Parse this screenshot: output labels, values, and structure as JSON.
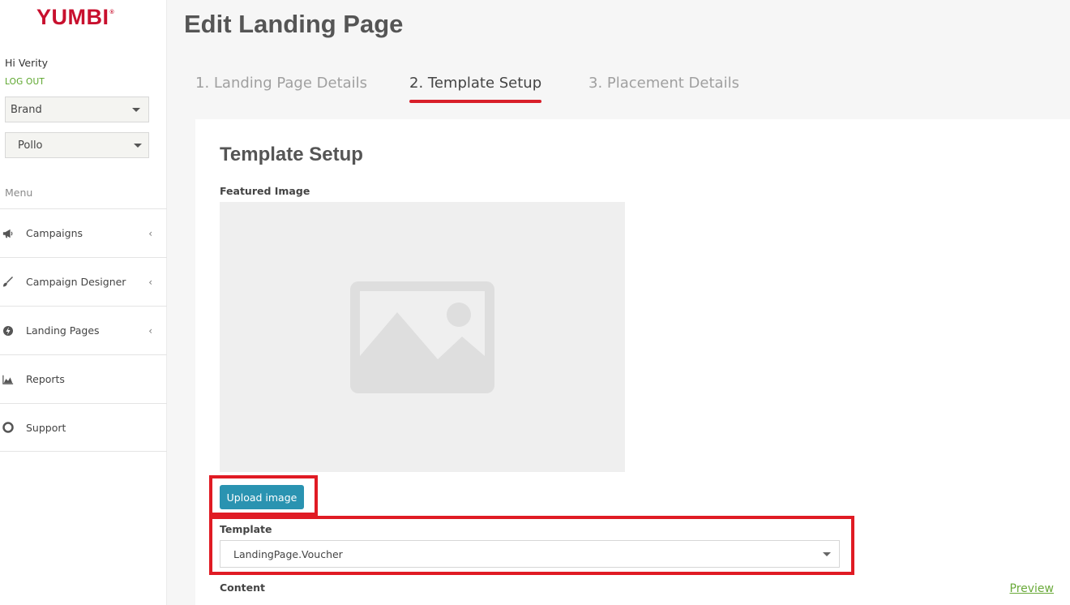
{
  "sidebar": {
    "logo": "YUMBI",
    "logo_mark": "®",
    "greeting": "Hi Verity",
    "logout": "LOG OUT",
    "brand_select": "Brand",
    "store_select": "Pollo",
    "menu_label": "Menu",
    "items": [
      {
        "label": "Campaigns",
        "icon": "megaphone-icon",
        "has_chevron": true
      },
      {
        "label": "Campaign Designer",
        "icon": "brush-icon",
        "has_chevron": true
      },
      {
        "label": "Landing Pages",
        "icon": "lightning-icon",
        "has_chevron": true
      },
      {
        "label": "Reports",
        "icon": "chart-icon",
        "has_chevron": false
      },
      {
        "label": "Support",
        "icon": "lifebuoy-icon",
        "has_chevron": false
      }
    ]
  },
  "header": {
    "title": "Edit Landing Page"
  },
  "steps": [
    {
      "label": "1. Landing Page Details",
      "active": false
    },
    {
      "label": "2. Template Setup",
      "active": true
    },
    {
      "label": "3. Placement Details",
      "active": false
    }
  ],
  "form": {
    "title": "Template Setup",
    "featured_image_label": "Featured Image",
    "upload_button": "Upload image",
    "template_label": "Template",
    "template_value": "LandingPage.Voucher",
    "content_label": "Content",
    "preview_link": "Preview"
  },
  "colors": {
    "brand_red": "#c8102e",
    "accent_red": "#e01b24",
    "button_blue": "#2a93b1",
    "link_green": "#6aaa3a"
  }
}
